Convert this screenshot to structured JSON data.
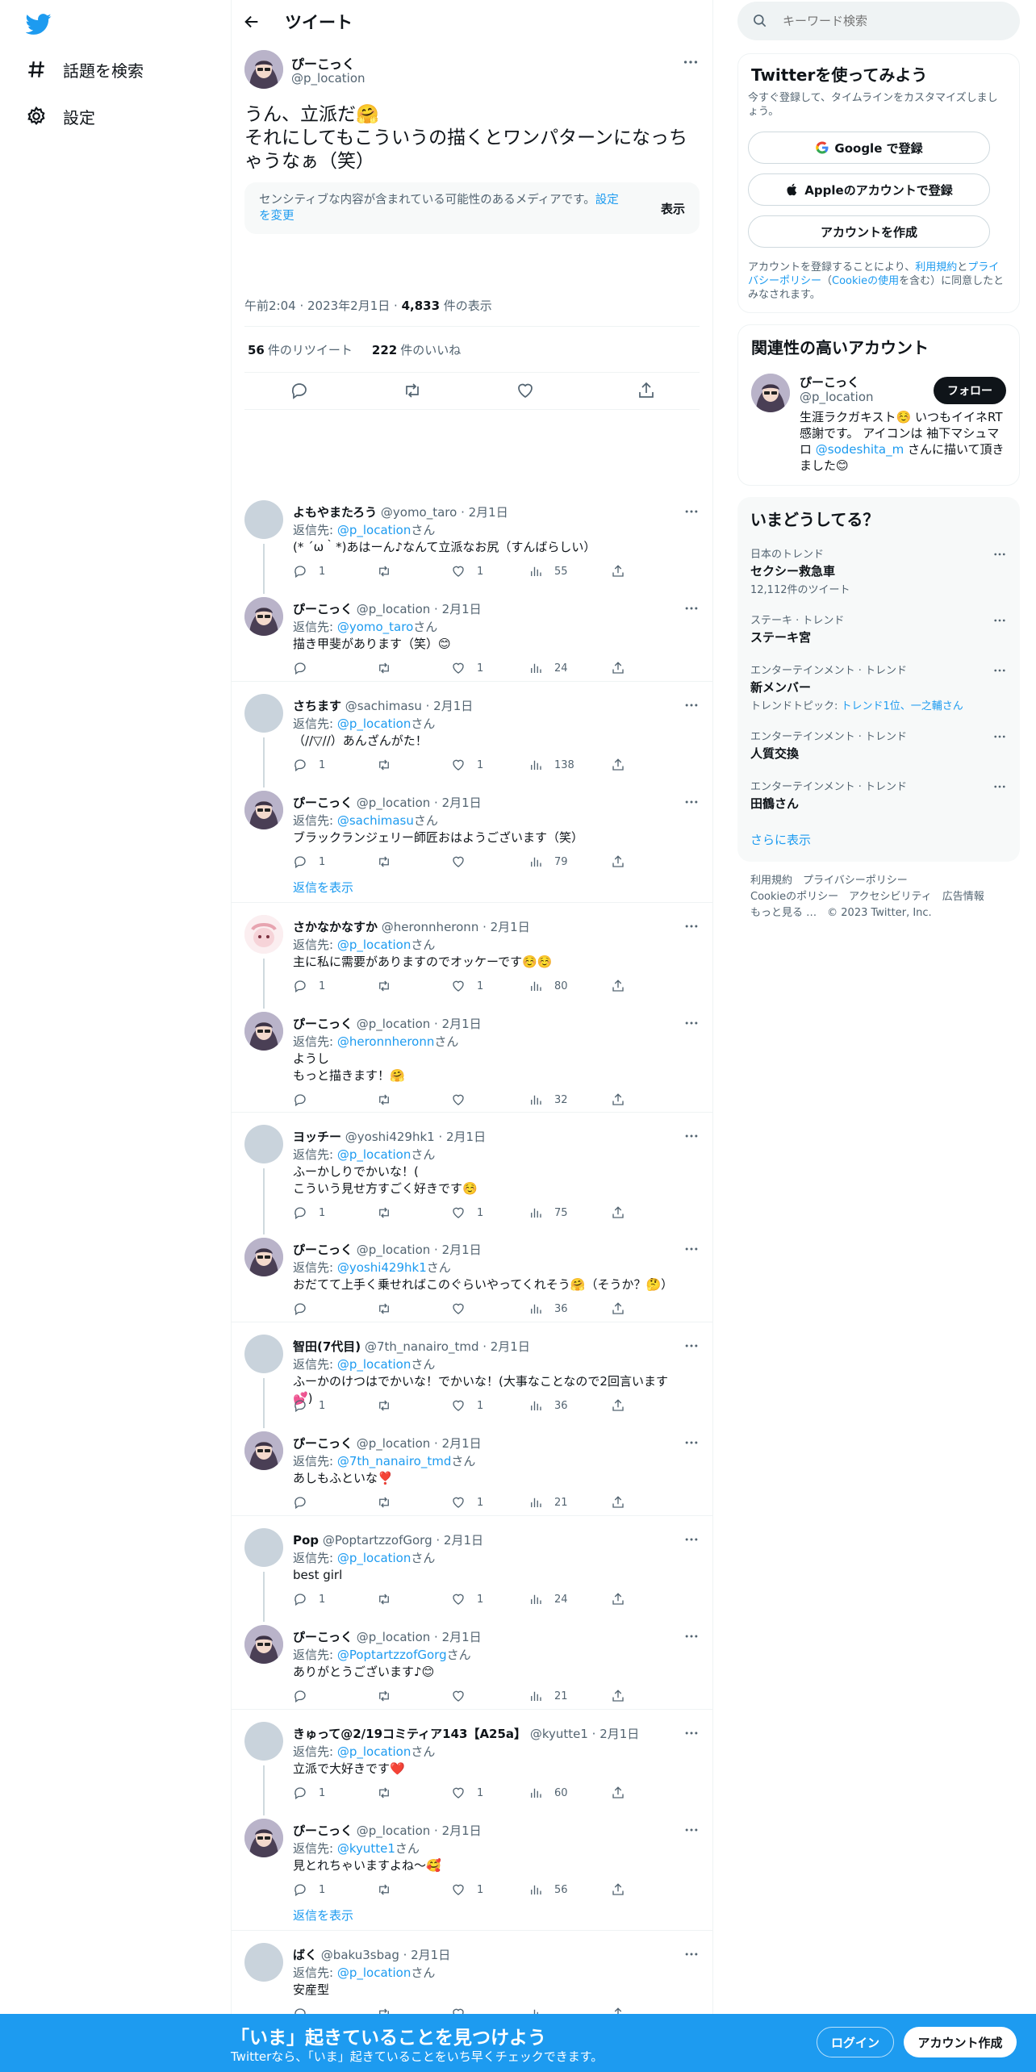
{
  "nav": {
    "explore": "話題を検索",
    "settings": "設定"
  },
  "header": {
    "title": "ツイート"
  },
  "main_tweet": {
    "name": "ぴーこっく",
    "handle": "@p_location",
    "text": "うん、立派だ🤗\nそれにしてもこういうの描くとワンパターンになっちゃうなぁ（笑）",
    "sensitive_text": "センシティブな内容が含まれている可能性のあるメディアです。",
    "sensitive_link": "設定を変更",
    "sensitive_button": "表示",
    "time": "午前2:04 · 2023年2月1日 · ",
    "views_count": "4,833",
    "views_label": " 件の表示",
    "retweets_count": "56",
    "retweets_label": "件のリツイート",
    "likes_count": "222",
    "likes_label": "件のいいね"
  },
  "replies": [
    {
      "name": "よもやまたろう",
      "handle": "@yomo_taro · 2月1日",
      "reply_prefix": "返信先: ",
      "reply_to": "@p_location",
      "reply_suffix": "さん",
      "text": "(* ´ω｀*)あはーん♪なんて立派なお尻（すんばらしい）",
      "replies": "1",
      "retweets": "",
      "likes": "1",
      "views": "55"
    },
    {
      "name": "ぴーこっく",
      "handle": "@p_location · 2月1日",
      "reply_prefix": "返信先: ",
      "reply_to": "@yomo_taro",
      "reply_suffix": "さん",
      "text": "描き甲斐があります（笑）😊",
      "replies": "",
      "retweets": "",
      "likes": "1",
      "views": "24"
    },
    {
      "name": "さちます",
      "handle": "@sachimasu · 2月1日",
      "reply_prefix": "返信先: ",
      "reply_to": "@p_location",
      "reply_suffix": "さん",
      "text": "（//▽//）あんざんがた！",
      "replies": "1",
      "retweets": "",
      "likes": "1",
      "views": "138"
    },
    {
      "name": "ぴーこっく",
      "handle": "@p_location · 2月1日",
      "reply_prefix": "返信先: ",
      "reply_to": "@sachimasu",
      "reply_suffix": "さん",
      "text": "ブラックランジェリー師匠おはようございます（笑）",
      "replies": "1",
      "retweets": "",
      "likes": "",
      "views": "79"
    },
    {
      "name": "さかなかなすか",
      "handle": "@heronnheronn · 2月1日",
      "reply_prefix": "返信先: ",
      "reply_to": "@p_location",
      "reply_suffix": "さん",
      "text": "主に私に需要がありますのでオッケーです☺️☺️",
      "replies": "1",
      "retweets": "",
      "likes": "1",
      "views": "80"
    },
    {
      "name": "ぴーこっく",
      "handle": "@p_location · 2月1日",
      "reply_prefix": "返信先: ",
      "reply_to": "@heronnheronn",
      "reply_suffix": "さん",
      "text": "ようし\nもっと描きます！🤗",
      "replies": "",
      "retweets": "",
      "likes": "",
      "views": "32"
    },
    {
      "name": "ヨッチー",
      "handle": "@yoshi429hk1 · 2月1日",
      "reply_prefix": "返信先: ",
      "reply_to": "@p_location",
      "reply_suffix": "さん",
      "text": "ふーかしりでかいな！(\nこういう見せ方すごく好きです☺️",
      "replies": "1",
      "retweets": "",
      "likes": "1",
      "views": "75"
    },
    {
      "name": "ぴーこっく",
      "handle": "@p_location · 2月1日",
      "reply_prefix": "返信先: ",
      "reply_to": "@yoshi429hk1",
      "reply_suffix": "さん",
      "text": "おだてて上手く乗せればこのぐらいやってくれそう🤗（そうか？🤔）",
      "replies": "",
      "retweets": "",
      "likes": "",
      "views": "36"
    },
    {
      "name": "智田(7代目)",
      "handle": "@7th_nanairo_tmd · 2月1日",
      "reply_prefix": "返信先: ",
      "reply_to": "@p_location",
      "reply_suffix": "さん",
      "text": "ふーかのけつはでかいな！でかいな！(大事なことなので2回言います💕)",
      "replies": "1",
      "retweets": "",
      "likes": "1",
      "views": "36"
    },
    {
      "name": "ぴーこっく",
      "handle": "@p_location · 2月1日",
      "reply_prefix": "返信先: ",
      "reply_to": "@7th_nanairo_tmd",
      "reply_suffix": "さん",
      "text": "あしもふといな❣️",
      "replies": "",
      "retweets": "",
      "likes": "1",
      "views": "21"
    },
    {
      "name": "Pop",
      "handle": "@PoptartzzofGorg · 2月1日",
      "reply_prefix": "返信先: ",
      "reply_to": "@p_location",
      "reply_suffix": "さん",
      "text": "best girl",
      "replies": "1",
      "retweets": "",
      "likes": "1",
      "views": "24"
    },
    {
      "name": "ぴーこっく",
      "handle": "@p_location · 2月1日",
      "reply_prefix": "返信先: ",
      "reply_to": "@PoptartzzofGorg",
      "reply_suffix": "さん",
      "text": "ありがとうございます♪😊",
      "replies": "",
      "retweets": "",
      "likes": "",
      "views": "21"
    },
    {
      "name": "きゅって@2/19コミティア143【A25a】",
      "handle": "@kyutte1 · 2月1日",
      "reply_prefix": "返信先: ",
      "reply_to": "@p_location",
      "reply_suffix": "さん",
      "text": "立派で大好きです❤️",
      "replies": "1",
      "retweets": "",
      "likes": "1",
      "views": "60"
    },
    {
      "name": "ぴーこっく",
      "handle": "@p_location · 2月1日",
      "reply_prefix": "返信先: ",
      "reply_to": "@kyutte1",
      "reply_suffix": "さん",
      "text": "見とれちゃいますよね〜🥰",
      "replies": "1",
      "retweets": "",
      "likes": "1",
      "views": "56"
    },
    {
      "name": "ばく",
      "handle": "@baku3sbag · 2月1日",
      "reply_prefix": "返信先: ",
      "reply_to": "@p_location",
      "reply_suffix": "さん",
      "text": "安産型",
      "replies": "",
      "retweets": "",
      "likes": "",
      "views": ""
    }
  ],
  "show_replies": "返信を表示",
  "right": {
    "search_placeholder": "キーワード検索",
    "signup": {
      "title": "Twitterを使ってみよう",
      "desc": "今すぐ登録して、タイムラインをカスタマイズしましょう。",
      "google": "Google で登録",
      "apple": "Appleのアカウントで登録",
      "create": "アカウントを作成",
      "terms_1": "アカウントを登録することにより、",
      "terms_link1": "利用規約",
      "terms_2": "と",
      "terms_link2": "プライバシーポリシー",
      "terms_3": "（",
      "terms_link3": "Cookieの使用",
      "terms_4": "を含む）に同意したとみなされます。"
    },
    "related": {
      "title": "関連性の高いアカウント",
      "name": "ぴーこっく",
      "handle": "@p_location",
      "follow": "フォロー",
      "bio_1": "生涯ラクガキスト☺️ いつもイイネRT感謝です。 アイコンは 袖下マシュマロ ",
      "bio_link": "@sodeshita_m",
      "bio_2": " さんに描いて頂きました😊"
    },
    "trends": {
      "title": "いまどうしてる？",
      "items": [
        {
          "cat": "日本のトレンド",
          "name": "セクシー救急車",
          "sub": "12,112件のツイート"
        },
        {
          "cat": "ステーキ · トレンド",
          "name": "ステーキ宮",
          "sub": ""
        },
        {
          "cat": "エンターテインメント · トレンド",
          "name": "新メンバー",
          "sub": "トレンドトピック: ",
          "sub_link": "トレンド1位、一之輔さん"
        },
        {
          "cat": "エンターテインメント · トレンド",
          "name": "人質交換",
          "sub": ""
        },
        {
          "cat": "エンターテインメント · トレンド",
          "name": "田鶴さん",
          "sub": ""
        }
      ],
      "more": "さらに表示"
    },
    "footer": {
      "line1a": "利用規約",
      "line1b": "プライバシーポリシー",
      "line2a": "Cookieのポリシー",
      "line2b": "アクセシビリティ",
      "line2c": "広告情報",
      "line3a": "もっと見る …",
      "line3b": "© 2023 Twitter, Inc."
    }
  },
  "bottom": {
    "title": "「いま」起きていることを見つけよう",
    "sub": "Twitterなら、「いま」起きていることをいち早くチェックできます。",
    "login": "ログイン",
    "signup": "アカウント作成"
  },
  "colors": {
    "accent": "#1d9bf0",
    "text": "#0f1419",
    "muted": "#536471"
  }
}
